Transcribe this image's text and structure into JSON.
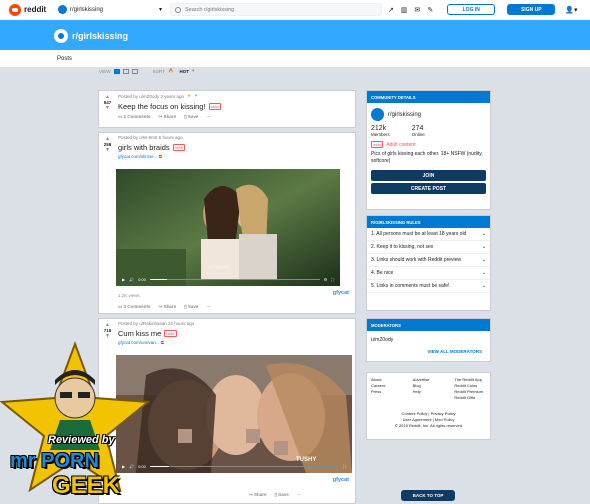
{
  "topbar": {
    "logo_text": "reddit",
    "community_selector": "r/girlskissing",
    "search_placeholder": "Search r/girlskissing",
    "login_label": "LOG IN",
    "signup_label": "SIGN UP"
  },
  "header": {
    "community_name": "r/girlskissing",
    "tab_posts": "Posts"
  },
  "view": {
    "view_label": "VIEW",
    "sort_label": "SORT",
    "sort_value": "HOT"
  },
  "posts": [
    {
      "votes": "547",
      "meta": "Posted by u/mZ0ody 2 years ago",
      "title": "Keep the focus on kissing!",
      "nsfw": "nsfw",
      "comments": "2 Comments",
      "share": "Share",
      "save": "Save",
      "more": "···"
    },
    {
      "votes": "259",
      "meta": "Posted by u/W-9m0 5 hours ago",
      "title": "girls with braids",
      "nsfw": "nsfw",
      "link": "gfycat.com/slimse...",
      "views": "1.2K views",
      "comments": "3 Comments",
      "share": "Share",
      "save": "Save",
      "more": "···",
      "gfycat": "gfycat",
      "video_time": "0:00",
      "video_watermark": "ULTRAFILMS"
    },
    {
      "votes": "716",
      "meta": "Posted by u/Rakinhasan 22 hours ago",
      "title": "Cum kiss me",
      "nsfw": "nsfw",
      "link": "gfycat.com/unevan...",
      "share": "Share",
      "save": "Save",
      "more": "···",
      "gfycat": "gfycat",
      "video_time": "0:00",
      "video_watermark": "TUSHY"
    }
  ],
  "community_details": {
    "header": "COMMUNITY DETAILS",
    "name": "r/girlskissing",
    "members_count": "212k",
    "members_label": "Members",
    "online_count": "274",
    "online_label": "Online",
    "nsfw_badge": "nsfw",
    "adult_label": "Adult content",
    "description": "Pics of girls kissing each other. 18+ NSFW (nudity, softcore)",
    "join_label": "JOIN",
    "create_post_label": "CREATE POST"
  },
  "rules": {
    "header": "R/GIRLSKISSING RULES",
    "items": [
      "1. All persons must be at least 18 years old",
      "2. Keep it to kissing, not sex",
      "3. Links should work with Reddit preview",
      "4. Be nice",
      "5. Links in comments must be safe!"
    ]
  },
  "moderators": {
    "header": "MODERATORS",
    "list": [
      "u/mZ0ody"
    ],
    "view_all": "VIEW ALL MODERATORS"
  },
  "footer": {
    "col1": [
      "About",
      "Careers",
      "Press"
    ],
    "col2": [
      "Advertise",
      "Blog",
      "Help"
    ],
    "col3": [
      "The Reddit App",
      "Reddit Coins",
      "Reddit Premium",
      "Reddit Gifts"
    ],
    "policy_line1": "Content Policy | Privacy Policy",
    "policy_line2": "User Agreement | Mod Policy",
    "copyright": "© 2019 Reddit, Inc. All rights reserved"
  },
  "back_to_top": "BACK TO TOP",
  "watermark": {
    "line1": "Reviewed by",
    "line2": "mr PORN",
    "line3": "GEEK"
  },
  "colors": {
    "accent": "#0079d3",
    "banner": "#33a8ff",
    "nsfw": "#ff585b",
    "navy": "#0e3b63"
  }
}
